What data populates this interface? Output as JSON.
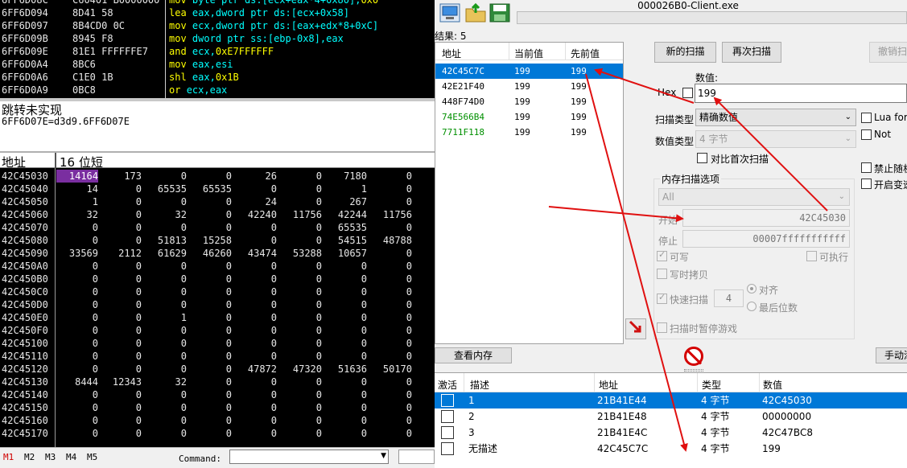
{
  "disasm": {
    "rows": [
      {
        "addr": "6FF6D08C",
        "bytes": "C60401 B0000000",
        "mn": "mov",
        "ops": [
          {
            "t": "byte ptr ds:[ecx+eax*4+0x80]",
            "c": "op"
          },
          {
            "t": ",",
            "c": "op"
          },
          {
            "t": "0x0",
            "c": "num"
          }
        ]
      },
      {
        "addr": "6FF6D094",
        "bytes": "8D41 58",
        "mn": "lea",
        "ops": [
          {
            "t": "eax",
            "c": "op"
          },
          {
            "t": ",",
            "c": "op"
          },
          {
            "t": "dword ptr ds:[ecx+0x58]",
            "c": "op"
          }
        ]
      },
      {
        "addr": "6FF6D097",
        "bytes": "8B4CD0 0C",
        "mn": "mov",
        "ops": [
          {
            "t": "ecx",
            "c": "op"
          },
          {
            "t": ",",
            "c": "op"
          },
          {
            "t": "dword ptr ds:[eax+edx*8+0xC]",
            "c": "op"
          }
        ]
      },
      {
        "addr": "6FF6D09B",
        "bytes": "8945 F8",
        "mn": "mov",
        "ops": [
          {
            "t": "dword ptr ss:[ebp-0x8]",
            "c": "op"
          },
          {
            "t": ",",
            "c": "op"
          },
          {
            "t": "eax",
            "c": "op"
          }
        ]
      },
      {
        "addr": "6FF6D09E",
        "bytes": "81E1 FFFFFFE7",
        "mn": "and",
        "ops": [
          {
            "t": "ecx",
            "c": "op"
          },
          {
            "t": ",",
            "c": "op"
          },
          {
            "t": "0xE7FFFFFF",
            "c": "num"
          }
        ]
      },
      {
        "addr": "6FF6D0A4",
        "bytes": "8BC6",
        "mn": "mov",
        "ops": [
          {
            "t": "eax",
            "c": "op"
          },
          {
            "t": ",",
            "c": "op"
          },
          {
            "t": "esi",
            "c": "op"
          }
        ]
      },
      {
        "addr": "6FF6D0A6",
        "bytes": "C1E0 1B",
        "mn": "shl",
        "ops": [
          {
            "t": "eax",
            "c": "op"
          },
          {
            "t": ",",
            "c": "op"
          },
          {
            "t": "0x1B",
            "c": "num"
          }
        ]
      },
      {
        "addr": "6FF6D0A9",
        "bytes": "0BC8",
        "mn": "or",
        "ops": [
          {
            "t": "ecx",
            "c": "op"
          },
          {
            "t": ",",
            "c": "op"
          },
          {
            "t": "eax",
            "c": "op"
          }
        ]
      }
    ]
  },
  "info": {
    "line1": "跳转未实现",
    "line2": "6FF6D07E=d3d9.6FF6D07E"
  },
  "dump": {
    "header_addr": "地址",
    "header_mode": "16 位短",
    "rows": [
      {
        "addr": "42C45030",
        "vals": [
          "14164",
          "173",
          "0",
          "0",
          "26",
          "0",
          "7180",
          "0"
        ]
      },
      {
        "addr": "42C45040",
        "vals": [
          "14",
          "0",
          "65535",
          "65535",
          "0",
          "0",
          "1",
          "0"
        ]
      },
      {
        "addr": "42C45050",
        "vals": [
          "1",
          "0",
          "0",
          "0",
          "24",
          "0",
          "267",
          "0"
        ]
      },
      {
        "addr": "42C45060",
        "vals": [
          "32",
          "0",
          "32",
          "0",
          "42240",
          "11756",
          "42244",
          "11756"
        ]
      },
      {
        "addr": "42C45070",
        "vals": [
          "0",
          "0",
          "0",
          "0",
          "0",
          "0",
          "65535",
          "0"
        ]
      },
      {
        "addr": "42C45080",
        "vals": [
          "0",
          "0",
          "51813",
          "15258",
          "0",
          "0",
          "54515",
          "48788"
        ]
      },
      {
        "addr": "42C45090",
        "vals": [
          "33569",
          "2112",
          "61629",
          "46260",
          "43474",
          "53288",
          "10657",
          "0"
        ]
      },
      {
        "addr": "42C450A0",
        "vals": [
          "0",
          "0",
          "0",
          "0",
          "0",
          "0",
          "0",
          "0"
        ]
      },
      {
        "addr": "42C450B0",
        "vals": [
          "0",
          "0",
          "0",
          "0",
          "0",
          "0",
          "0",
          "0"
        ]
      },
      {
        "addr": "42C450C0",
        "vals": [
          "0",
          "0",
          "0",
          "0",
          "0",
          "0",
          "0",
          "0"
        ]
      },
      {
        "addr": "42C450D0",
        "vals": [
          "0",
          "0",
          "0",
          "0",
          "0",
          "0",
          "0",
          "0"
        ]
      },
      {
        "addr": "42C450E0",
        "vals": [
          "0",
          "0",
          "1",
          "0",
          "0",
          "0",
          "0",
          "0"
        ]
      },
      {
        "addr": "42C450F0",
        "vals": [
          "0",
          "0",
          "0",
          "0",
          "0",
          "0",
          "0",
          "0"
        ]
      },
      {
        "addr": "42C45100",
        "vals": [
          "0",
          "0",
          "0",
          "0",
          "0",
          "0",
          "0",
          "0"
        ]
      },
      {
        "addr": "42C45110",
        "vals": [
          "0",
          "0",
          "0",
          "0",
          "0",
          "0",
          "0",
          "0"
        ]
      },
      {
        "addr": "42C45120",
        "vals": [
          "0",
          "0",
          "0",
          "0",
          "47872",
          "47320",
          "51636",
          "50170"
        ]
      },
      {
        "addr": "42C45130",
        "vals": [
          "8444",
          "12343",
          "32",
          "0",
          "0",
          "0",
          "0",
          "0"
        ]
      },
      {
        "addr": "42C45140",
        "vals": [
          "0",
          "0",
          "0",
          "0",
          "0",
          "0",
          "0",
          "0"
        ]
      },
      {
        "addr": "42C45150",
        "vals": [
          "0",
          "0",
          "0",
          "0",
          "0",
          "0",
          "0",
          "0"
        ]
      },
      {
        "addr": "42C45160",
        "vals": [
          "0",
          "0",
          "0",
          "0",
          "0",
          "0",
          "0",
          "0"
        ]
      },
      {
        "addr": "42C45170",
        "vals": [
          "0",
          "0",
          "0",
          "0",
          "0",
          "0",
          "0",
          "0"
        ]
      }
    ]
  },
  "dbg_bottom": {
    "tabs": [
      "M1",
      "M2",
      "M3",
      "M4",
      "M5"
    ],
    "command_label": "Command:"
  },
  "ce": {
    "title": "000026B0-Client.exe",
    "results": "结果: 5",
    "found": {
      "col_addr": "地址",
      "col_cur": "当前值",
      "col_prev": "先前值",
      "rows": [
        {
          "addr": "42C45C7C",
          "cur": "199",
          "prev": "199",
          "green": false
        },
        {
          "addr": "42E21F40",
          "cur": "199",
          "prev": "199",
          "green": false
        },
        {
          "addr": "448F74D0",
          "cur": "199",
          "prev": "199",
          "green": false
        },
        {
          "addr": "74E566B4",
          "cur": "199",
          "prev": "199",
          "green": true
        },
        {
          "addr": "7711F118",
          "cur": "199",
          "prev": "199",
          "green": true
        }
      ]
    },
    "buttons": {
      "new_scan": "新的扫描",
      "next_scan": "再次扫描",
      "undo_scan": "撤销扫",
      "view_memory": "查看内存",
      "manual_add": "手动添"
    },
    "value_label": "数值:",
    "hex_label": "Hex",
    "value": "199",
    "scan_type_label": "扫描类型",
    "scan_type": "精确数值",
    "value_type_label": "数值类型",
    "value_type": "4 字节",
    "compare_first": "对比首次扫描",
    "lua_formula": "Lua for",
    "not_label": "Not",
    "no_random": "禁止随机",
    "speedhack": "开启变速",
    "mem_options_title": "内存扫描选项",
    "region": "All",
    "start_label": "开始",
    "start_value": "42C45030",
    "stop_label": "停止",
    "stop_value": "00007fffffffffff",
    "writable": "可写",
    "executable": "可执行",
    "copy_on_write": "写时拷贝",
    "fast_scan": "快速扫描",
    "fast_scan_value": "4",
    "align": "对齐",
    "last_digits": "最后位数",
    "pause_game": "扫描时暂停游戏",
    "addr_list": {
      "col_active": "激活",
      "col_desc": "描述",
      "col_addr": "地址",
      "col_type": "类型",
      "col_value": "数值",
      "rows": [
        {
          "desc": "1",
          "addr": "21B41E44",
          "type": "4 字节",
          "value": "42C45030"
        },
        {
          "desc": "2",
          "addr": "21B41E48",
          "type": "4 字节",
          "value": "00000000"
        },
        {
          "desc": "3",
          "addr": "21B41E4C",
          "type": "4 字节",
          "value": "42C47BC8"
        },
        {
          "desc": "无描述",
          "addr": "42C45C7C",
          "type": "4 字节",
          "value": "199"
        }
      ]
    }
  },
  "colors": {
    "highlight": "#7a2ea0",
    "selection": "#0078d7",
    "annotation": "#e01010"
  }
}
